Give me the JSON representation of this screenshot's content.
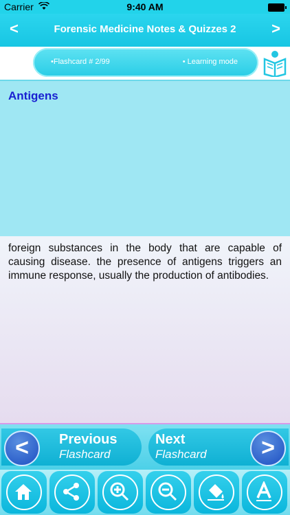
{
  "status": {
    "carrier": "Carrier",
    "time": "9:40 AM"
  },
  "nav": {
    "title": "Forensic Medicine Notes & Quizzes 2",
    "back": "<",
    "forward": ">"
  },
  "info": {
    "flashcard": "•Flashcard #  2/99",
    "mode": "• Learning mode"
  },
  "card": {
    "term": "Antigens",
    "definition": "foreign substances in the body that are capable of causing disease. the presence of antigens triggers an immune response, usually the production of antibodies."
  },
  "buttons": {
    "previous": {
      "line1": "Previous",
      "line2": "Flashcard",
      "arrow": "<"
    },
    "next": {
      "line1": "Next",
      "line2": "Flashcard",
      "arrow": ">"
    }
  },
  "toolbar": [
    {
      "icon": "home-icon"
    },
    {
      "icon": "share-icon"
    },
    {
      "icon": "zoom-in-icon"
    },
    {
      "icon": "zoom-out-icon"
    },
    {
      "icon": "paint-bucket-icon"
    },
    {
      "icon": "font-icon"
    }
  ],
  "colors": {
    "accent": "#22d3ea",
    "term": "#1a21d1",
    "button": "#1d4fc2"
  }
}
